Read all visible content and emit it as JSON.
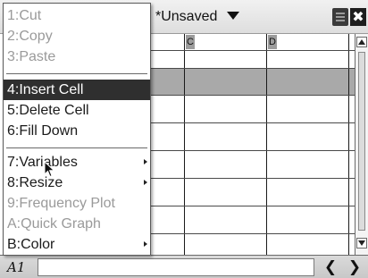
{
  "topbar": {
    "document_title": "*Unsaved",
    "dropdown_icon": "triangle-down-icon",
    "battery_icon": "battery-icon",
    "close_icon": "close-icon",
    "close_glyph": "✖"
  },
  "grid": {
    "column_headers": [
      "C",
      "D"
    ]
  },
  "scrollbar": {
    "up_icon": "scroll-up-arrow-icon",
    "down_icon": "scroll-down-arrow-icon"
  },
  "context_menu": {
    "items": [
      {
        "label": "1:Cut",
        "enabled": false
      },
      {
        "label": "2:Copy",
        "enabled": false
      },
      {
        "label": "3:Paste",
        "enabled": false
      },
      {
        "label": "4:Insert Cell",
        "enabled": true,
        "highlighted": true
      },
      {
        "label": "5:Delete Cell",
        "enabled": true
      },
      {
        "label": "6:Fill Down",
        "enabled": true
      },
      {
        "label": "7:Variables",
        "enabled": true,
        "submenu": true
      },
      {
        "label": "8:Resize",
        "enabled": true,
        "submenu": true
      },
      {
        "label": "9:Frequency Plot",
        "enabled": false
      },
      {
        "label": "A:Quick Graph",
        "enabled": false
      },
      {
        "label": "B:Color",
        "enabled": true,
        "submenu": true
      }
    ]
  },
  "bottombar": {
    "cell_reference": "A1",
    "cell_value": "",
    "prev_label": "❮",
    "next_label": "❯"
  },
  "colors": {
    "highlight_bg": "#2f2f2f",
    "disabled_text": "#9a9a9a",
    "selected_row": "#a9a9a9",
    "column_header_bg": "#9c9c9c"
  }
}
